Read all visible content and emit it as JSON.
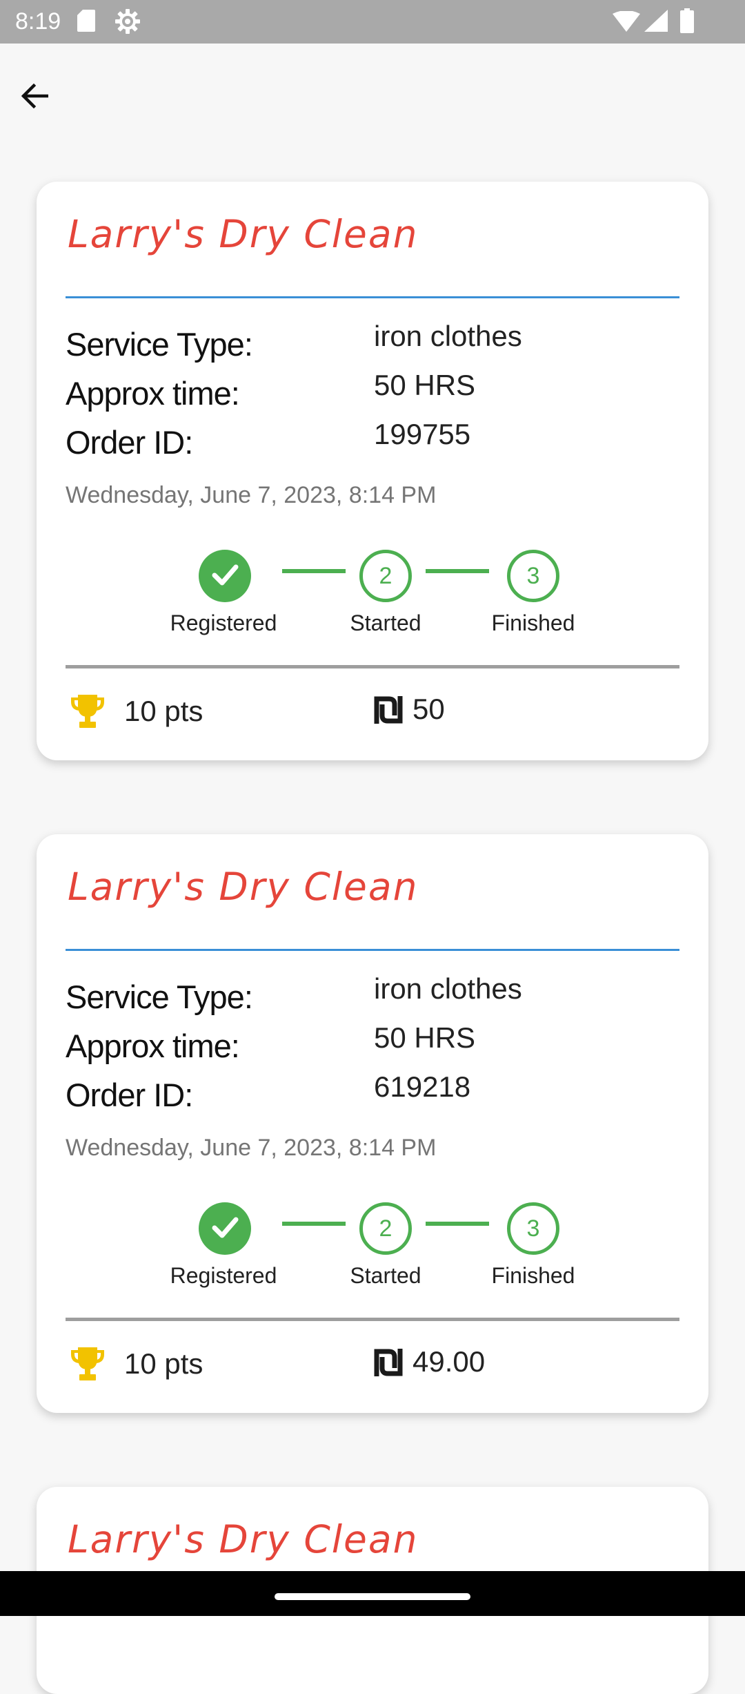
{
  "status_bar": {
    "time": "8:19",
    "icons": [
      "sd-card-icon",
      "settings-gear-icon",
      "wifi-icon",
      "signal-icon",
      "battery-icon"
    ]
  },
  "app_bar": {
    "back_icon": "arrow-left-icon"
  },
  "colors": {
    "title": "#e5453a",
    "divider": "#3a8fd6",
    "step_green": "#4caf50",
    "trophy": "#f2c200",
    "background": "#f7f7f7"
  },
  "labels": {
    "service_type": "Service Type:",
    "approx_time": "Approx time:",
    "order_id": "Order ID:"
  },
  "steps": [
    "Registered",
    "Started",
    "Finished"
  ],
  "step_numbers": [
    "2",
    "3"
  ],
  "orders": [
    {
      "shop_name": "Larry's Dry Clean",
      "service_type": "iron clothes",
      "approx_time": "50 HRS",
      "order_id": "199755",
      "date": "Wednesday, June 7, 2023, 8:14 PM",
      "points": "10 pts",
      "price": "50",
      "completed_steps": 1
    },
    {
      "shop_name": "Larry's Dry Clean",
      "service_type": "iron clothes",
      "approx_time": "50 HRS",
      "order_id": "619218",
      "date": "Wednesday, June 7, 2023, 8:14 PM",
      "points": "10 pts",
      "price": "49.00",
      "completed_steps": 1
    },
    {
      "shop_name": "Larry's Dry Clean"
    }
  ]
}
